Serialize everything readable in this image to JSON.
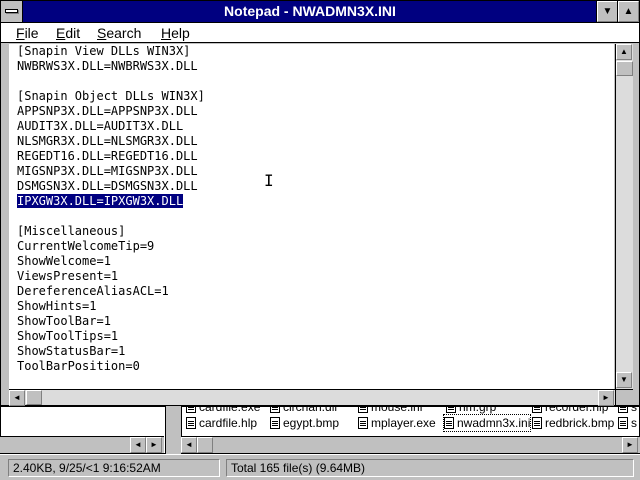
{
  "window": {
    "title": "Notepad - NWADMN3X.INI",
    "minimize_glyph": "▼",
    "maximize_glyph": "▲"
  },
  "menu": {
    "items": [
      {
        "accel": "F",
        "rest": "ile"
      },
      {
        "accel": "E",
        "rest": "dit"
      },
      {
        "accel": "S",
        "rest": "earch"
      },
      {
        "accel": "H",
        "rest": "elp"
      }
    ]
  },
  "editor": {
    "lines": [
      "[Snapin View DLLs WIN3X]",
      "NWBRWS3X.DLL=NWBRWS3X.DLL",
      "",
      "[Snapin Object DLLs WIN3X]",
      "APPSNP3X.DLL=APPSNP3X.DLL",
      "AUDIT3X.DLL=AUDIT3X.DLL",
      "NLSMGR3X.DLL=NLSMGR3X.DLL",
      "REGEDT16.DLL=REGEDT16.DLL",
      "MIGSNP3X.DLL=MIGSNP3X.DLL",
      "DSMGSN3X.DLL=DSMGSN3X.DLL",
      "IPXGW3X.DLL=IPXGW3X.DLL",
      "",
      "[Miscellaneous]",
      "CurrentWelcomeTip=9",
      "ShowWelcome=1",
      "ViewsPresent=1",
      "DereferenceAliasACL=1",
      "ShowHints=1",
      "ShowToolBar=1",
      "ShowToolTips=1",
      "ShowStatusBar=1",
      "ToolBarPosition=0"
    ],
    "selected_line_index": 10
  },
  "file_manager": {
    "top_row_files": [
      "cardfile.exe",
      "clrchan.dll",
      "mouse.ini",
      "nm.grp",
      "recorder.hlp",
      "s"
    ],
    "files": [
      "cardfile.hlp",
      "egypt.bmp",
      "mplayer.exe",
      "nwadmn3x.ini",
      "redbrick.bmp",
      "s"
    ],
    "selected_file_index": 3,
    "status_left": "2.40KB, 9/25/<1 9:16:52AM",
    "status_right": "Total 165 file(s) (9.64MB)"
  },
  "icons": {
    "up": "▲",
    "down": "▼",
    "left": "◄",
    "right": "►"
  }
}
